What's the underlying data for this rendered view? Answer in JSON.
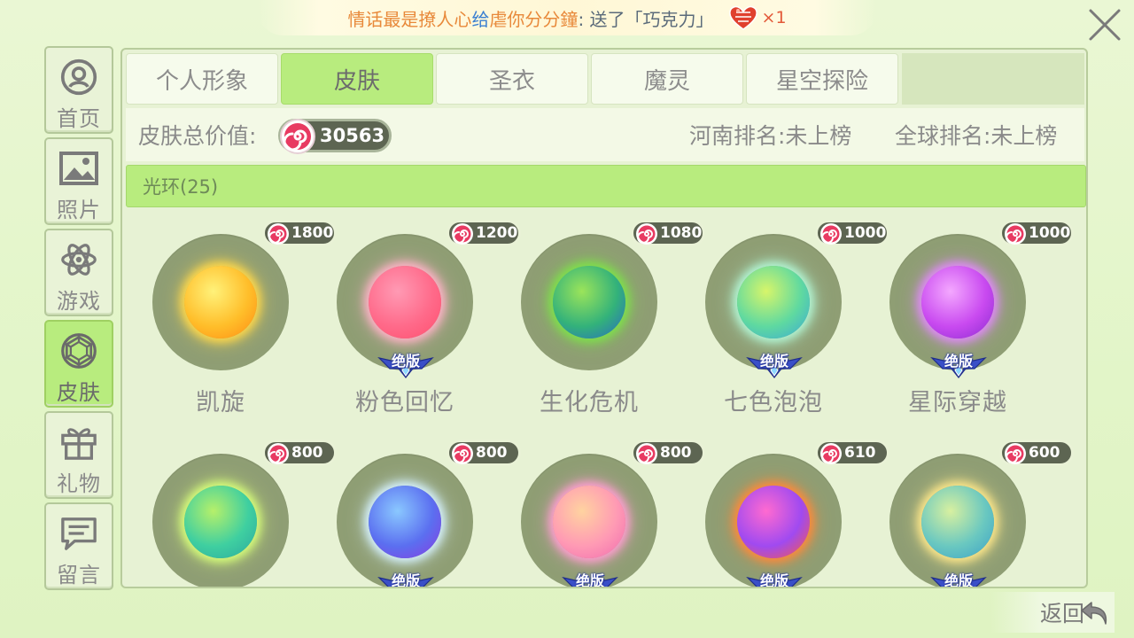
{
  "banner": {
    "part1": "情话最是撩人心",
    "part2": "给",
    "part3": "虐你分分鐘",
    "part4": ":  送了「巧克力」",
    "gift_count": "×1",
    "gift_icon": "heart-chocolate-icon"
  },
  "sidebar": {
    "items": [
      {
        "label": "首页",
        "icon": "user-circle-icon"
      },
      {
        "label": "照片",
        "icon": "photo-icon"
      },
      {
        "label": "游戏",
        "icon": "atom-icon"
      },
      {
        "label": "皮肤",
        "icon": "gem-icon",
        "active": true
      },
      {
        "label": "礼物",
        "icon": "gift-icon"
      },
      {
        "label": "留言",
        "icon": "message-icon"
      }
    ]
  },
  "tabs": [
    {
      "label": "个人形象"
    },
    {
      "label": "皮肤",
      "active": true
    },
    {
      "label": "圣衣"
    },
    {
      "label": "魔灵"
    },
    {
      "label": "星空探险"
    }
  ],
  "info": {
    "total_label": "皮肤总价值:",
    "total_value": "30563",
    "rank_province": "河南排名:未上榜",
    "rank_global": "全球排名:未上榜"
  },
  "category": {
    "label": "光环(25)"
  },
  "items": [
    {
      "name": "凯旋",
      "price": "1800",
      "badge": "",
      "colors": [
        "#fff27a",
        "#ffbe2a",
        "#ff8a12"
      ],
      "glow": "#ffd84a"
    },
    {
      "name": "粉色回忆",
      "price": "1200",
      "badge": "绝版",
      "colors": [
        "#ff9ab4",
        "#ff6a8a",
        "#ff4e6e"
      ],
      "glow": "#ffb3c8"
    },
    {
      "name": "生化危机",
      "price": "1080",
      "badge": "",
      "colors": [
        "#9be45a",
        "#33b27a",
        "#2a66c8"
      ],
      "glow": "#7ee24a"
    },
    {
      "name": "七色泡泡",
      "price": "1000",
      "badge": "绝版",
      "colors": [
        "#d7f56a",
        "#5fd9a0",
        "#3aa7d8"
      ],
      "glow": "#b3f7d6"
    },
    {
      "name": "星际穿越",
      "price": "1000",
      "badge": "绝版",
      "colors": [
        "#f4a8ff",
        "#c94af0",
        "#8a2ad0"
      ],
      "glow": "#e08af8"
    },
    {
      "name": "",
      "price": "800",
      "badge": "",
      "colors": [
        "#b6f06a",
        "#3fcfa0",
        "#2aa7a0"
      ],
      "glow": "#d8ff7a"
    },
    {
      "name": "",
      "price": "800",
      "badge": "绝版",
      "colors": [
        "#8ac8ff",
        "#5b6ff0",
        "#8a3ae0"
      ],
      "glow": "#d6f2ff"
    },
    {
      "name": "",
      "price": "800",
      "badge": "绝版",
      "colors": [
        "#ffd3a0",
        "#ff9ab4",
        "#f06ab0"
      ],
      "glow": "#ff9ed0"
    },
    {
      "name": "",
      "price": "610",
      "badge": "绝版",
      "colors": [
        "#ff6ad0",
        "#a04af0",
        "#ff5a3a"
      ],
      "glow": "#ff8a3a"
    },
    {
      "name": "",
      "price": "600",
      "badge": "绝版",
      "colors": [
        "#d8f0a0",
        "#6ac8c0",
        "#3aa0c8"
      ],
      "glow": "#ffe88a"
    }
  ],
  "back": {
    "label": "返回"
  }
}
